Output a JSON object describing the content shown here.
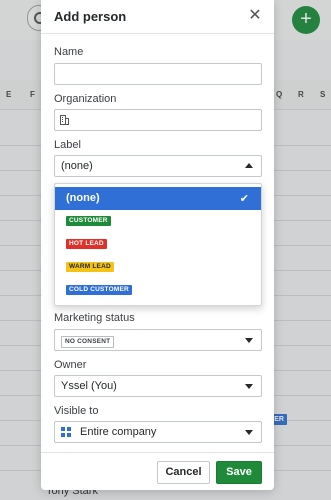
{
  "background": {
    "columns_left": [
      "E",
      "F"
    ],
    "columns_right": [
      "Q",
      "R",
      "S"
    ],
    "pill_text": "ER",
    "row_name": "Tony Stark",
    "add_icon": "plus-icon",
    "search_icon": "search-icon"
  },
  "modal": {
    "title": "Add person",
    "close_icon": "close-icon",
    "fields": {
      "name_label": "Name",
      "name_value": "",
      "organization_label": "Organization",
      "organization_value": "",
      "label_label": "Label",
      "label_value": "(none)",
      "marketing_label": "Marketing status",
      "marketing_value": "NO CONSENT",
      "owner_label": "Owner",
      "owner_value": "Yssel (You)",
      "visible_label": "Visible to",
      "visible_value": "Entire company"
    },
    "label_options": [
      {
        "text": "(none)",
        "selected": true,
        "tag": false
      },
      {
        "text": "CUSTOMER",
        "color": "#1f8a3a",
        "fg": "#ffffff",
        "tag": true
      },
      {
        "text": "HOT LEAD",
        "color": "#e0302a",
        "fg": "#ffffff",
        "tag": true
      },
      {
        "text": "WARM LEAD",
        "color": "#f3c316",
        "fg": "#26292c",
        "tag": true
      },
      {
        "text": "COLD CUSTOMER",
        "color": "#2f6fd6",
        "fg": "#ffffff",
        "tag": true
      }
    ],
    "footer": {
      "cancel_label": "Cancel",
      "save_label": "Save"
    }
  },
  "colors": {
    "accent_blue": "#2f6fd6",
    "save_green": "#1f8a3a"
  }
}
